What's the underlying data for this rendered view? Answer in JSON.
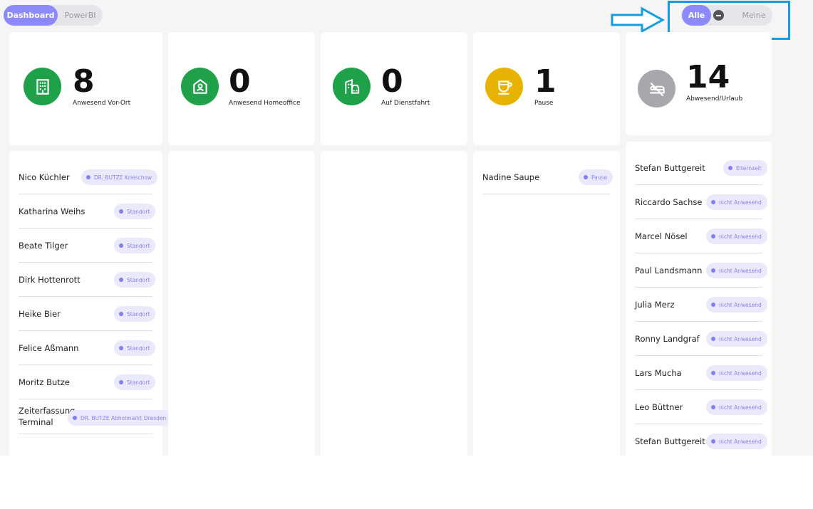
{
  "header": {
    "tabs": [
      {
        "label": "Dashboard"
      },
      {
        "label": "PowerBI"
      }
    ],
    "filter": {
      "all_label": "Alle",
      "mine_label": "Meine"
    },
    "annotation_color": "#169de0"
  },
  "stats": [
    {
      "value": "8",
      "label": "Anwesend Vor-Ort",
      "icon": "building-icon",
      "color": "#1fa14a"
    },
    {
      "value": "0",
      "label": "Anwesend Homeoffice",
      "icon": "home-icon",
      "color": "#1fa14a"
    },
    {
      "value": "0",
      "label": "Auf Dienstfahrt",
      "icon": "car-building-icon",
      "color": "#1fa14a"
    },
    {
      "value": "1",
      "label": "Pause",
      "icon": "coffee-cup-icon",
      "color": "#e8b300"
    },
    {
      "value": "14",
      "label": "Abwesend/Urlaub",
      "icon": "bed-crossed-icon",
      "color": "#a7a7ad"
    }
  ],
  "lists": {
    "vor_ort": [
      {
        "name": "Nico Küchler",
        "status": "DR. BUTZE Krieschow"
      },
      {
        "name": "Katharina Weihs",
        "status": "Standort"
      },
      {
        "name": "Beate Tilger",
        "status": "Standort"
      },
      {
        "name": "Dirk Hottenrott",
        "status": "Standort"
      },
      {
        "name": "Heike Bier",
        "status": "Standort"
      },
      {
        "name": "Felice Aßmann",
        "status": "Standort"
      },
      {
        "name": "Moritz Butze",
        "status": "Standort"
      },
      {
        "name": "Zeiterfassung Terminal",
        "status": "DR. BUTZE Abholmarkt Dresden"
      }
    ],
    "pause": [
      {
        "name": "Nadine Saupe",
        "status": "Pause"
      }
    ],
    "abwesend": [
      {
        "name": "Stefan Buttgereit",
        "status": "Elternzeit"
      },
      {
        "name": "Riccardo Sachse",
        "status": "nicht Anwesend"
      },
      {
        "name": "Marcel Nösel",
        "status": "nicht Anwesend"
      },
      {
        "name": "Paul Landsmann",
        "status": "nicht Anwesend"
      },
      {
        "name": "Julia Merz",
        "status": "nicht Anwesend"
      },
      {
        "name": "Ronny Landgraf",
        "status": "nicht Anwesend"
      },
      {
        "name": "Lars Mucha",
        "status": "nicht Anwesend"
      },
      {
        "name": "Leo Büttner",
        "status": "nicht Anwesend"
      },
      {
        "name": "Stefan Buttgereit",
        "status": "nicht Anwesend"
      }
    ]
  }
}
